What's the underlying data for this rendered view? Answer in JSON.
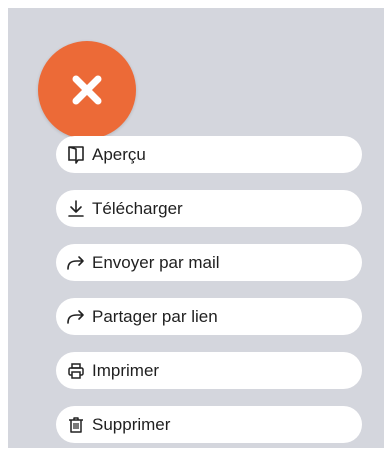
{
  "close_button": {
    "icon": "close-icon",
    "color": "#ec6a37"
  },
  "menu": {
    "items": [
      {
        "icon": "preview-icon",
        "label": "Aperçu"
      },
      {
        "icon": "download-icon",
        "label": "Télécharger"
      },
      {
        "icon": "share-arrow-icon",
        "label": "Envoyer par mail"
      },
      {
        "icon": "share-arrow-icon",
        "label": "Partager par lien"
      },
      {
        "icon": "printer-icon",
        "label": "Imprimer"
      },
      {
        "icon": "trash-icon",
        "label": "Supprimer"
      }
    ]
  },
  "colors": {
    "panel_bg": "#d4d6dd",
    "item_bg": "#ffffff",
    "text": "#1f1f1f",
    "accent": "#ec6a37"
  }
}
